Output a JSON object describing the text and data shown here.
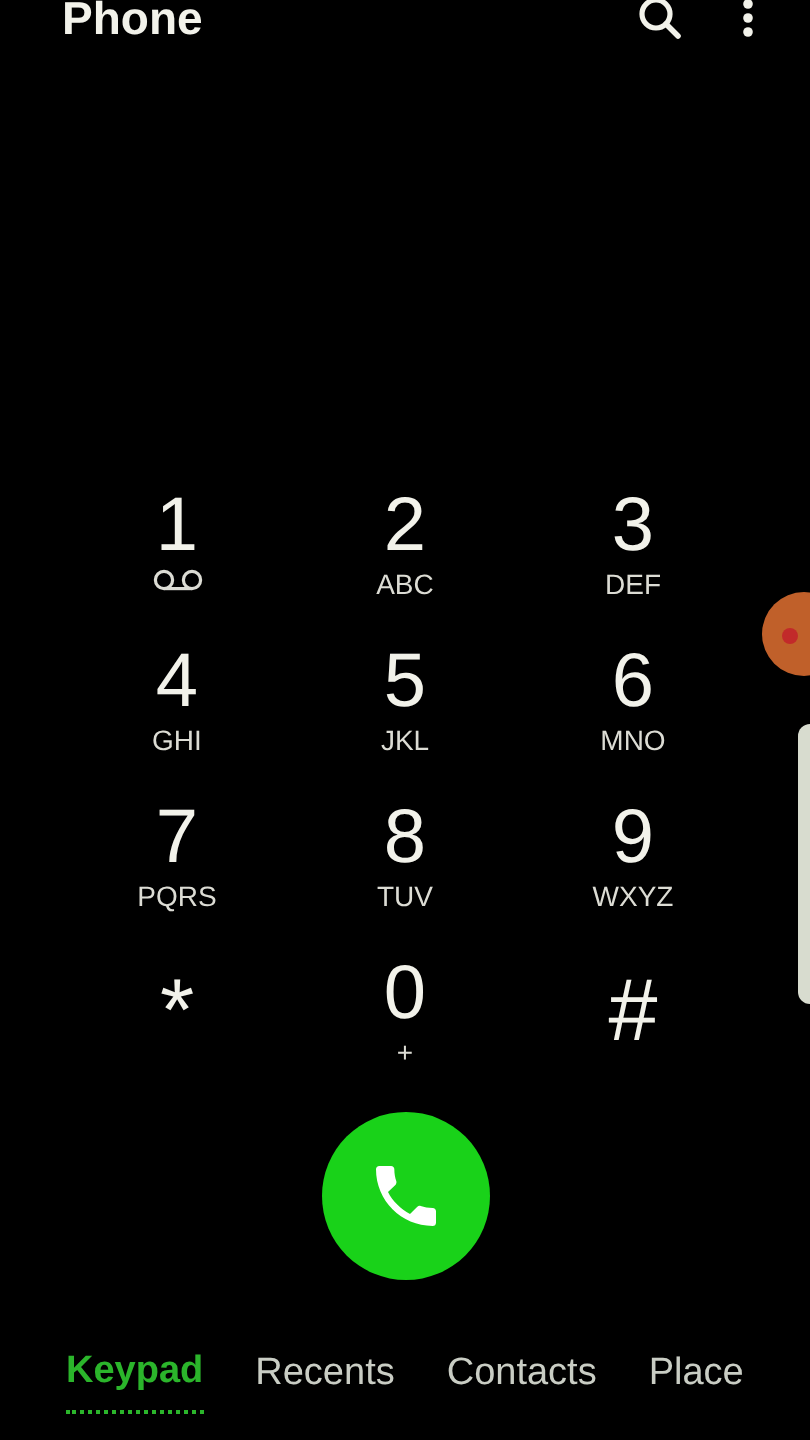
{
  "app_bar": {
    "title": "Phone"
  },
  "keys": [
    {
      "digit": "1",
      "kind": "voicemail"
    },
    {
      "digit": "2",
      "letters": "ABC",
      "kind": "letters"
    },
    {
      "digit": "3",
      "letters": "DEF",
      "kind": "letters"
    },
    {
      "digit": "4",
      "letters": "GHI",
      "kind": "letters"
    },
    {
      "digit": "5",
      "letters": "JKL",
      "kind": "letters"
    },
    {
      "digit": "6",
      "letters": "MNO",
      "kind": "letters"
    },
    {
      "digit": "7",
      "letters": "PQRS",
      "kind": "letters"
    },
    {
      "digit": "8",
      "letters": "TUV",
      "kind": "letters"
    },
    {
      "digit": "9",
      "letters": "WXYZ",
      "kind": "letters"
    },
    {
      "digit": "*",
      "kind": "symbol"
    },
    {
      "digit": "0",
      "letters": "+",
      "kind": "letters"
    },
    {
      "digit": "#",
      "kind": "symbol"
    }
  ],
  "tabs": [
    {
      "label": "Keypad",
      "selected": true
    },
    {
      "label": "Recents",
      "selected": false
    },
    {
      "label": "Contacts",
      "selected": false
    },
    {
      "label": "Place",
      "selected": false
    }
  ]
}
